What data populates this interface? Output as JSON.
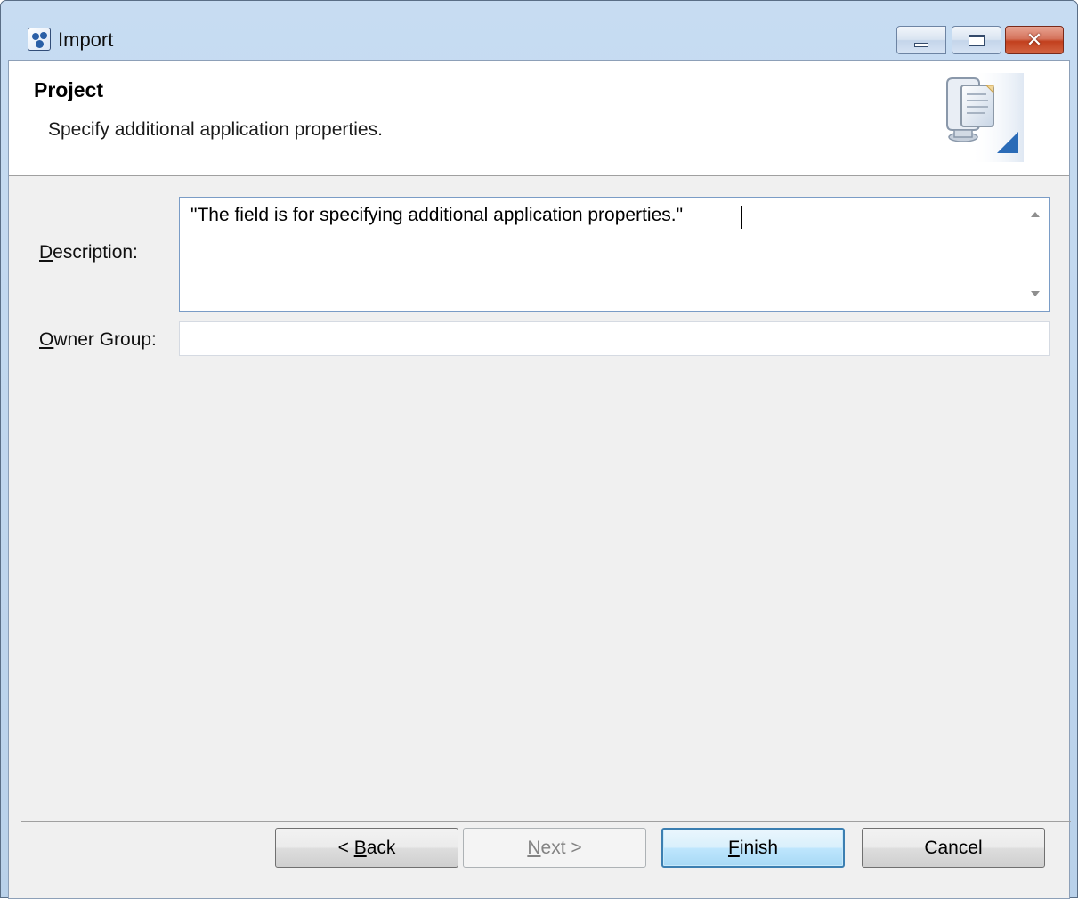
{
  "window": {
    "title": "Import",
    "app_icon": "eclipse-app-icon",
    "controls": {
      "minimize": "minimize-icon",
      "maximize": "maximize-icon",
      "close": "close-icon"
    }
  },
  "banner": {
    "title": "Project",
    "subtitle": "Specify additional application properties.",
    "icon": "import-wizard-icon"
  },
  "form": {
    "description": {
      "label_underlined": "D",
      "label_rest": "escription:",
      "value": "\"The field is for specifying additional application properties.\""
    },
    "owner_group": {
      "label_underlined": "O",
      "label_rest": "wner Group:",
      "value": ""
    }
  },
  "buttons": {
    "back": {
      "prefix": "< ",
      "underlined": "B",
      "rest": "ack"
    },
    "next": {
      "underlined": "N",
      "rest": "ext >"
    },
    "finish": {
      "underlined": "F",
      "rest": "inish"
    },
    "cancel": {
      "label": "Cancel"
    }
  }
}
